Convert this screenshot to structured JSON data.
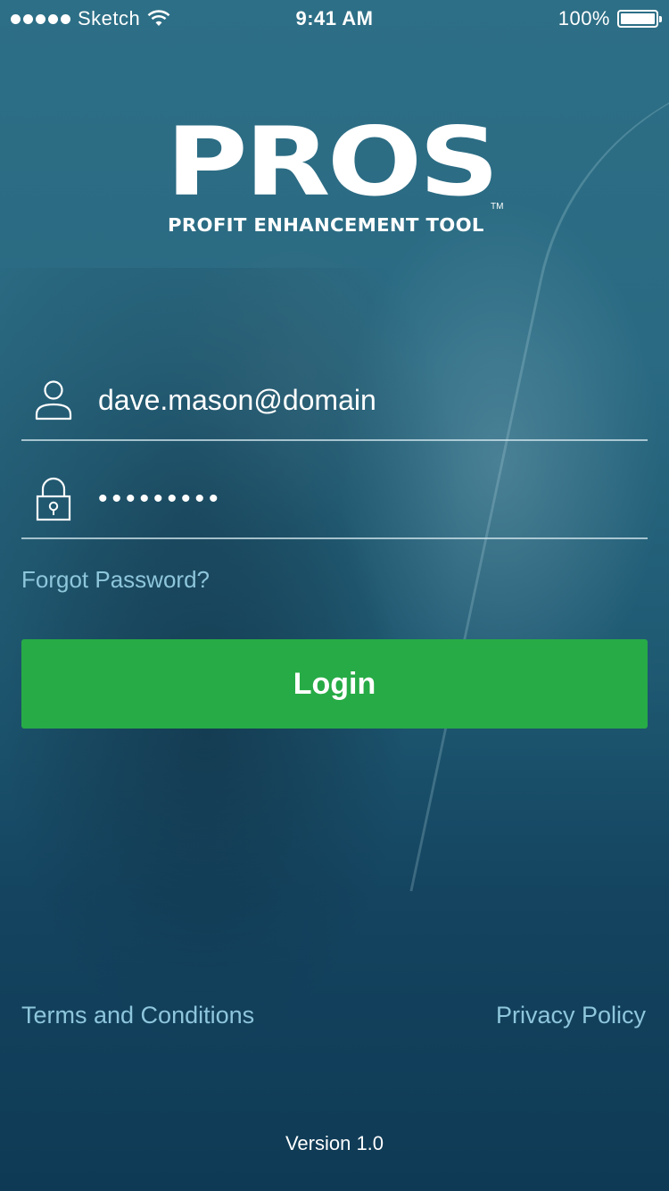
{
  "status_bar": {
    "carrier": "Sketch",
    "time": "9:41 AM",
    "battery_percent": "100%",
    "battery_level": 1.0
  },
  "logo": {
    "title": "PROS",
    "trademark": "TM",
    "subtitle": "PROFIT ENHANCEMENT TOOL"
  },
  "form": {
    "username_value": "dave.mason@domain",
    "password_value": "•••••••••",
    "forgot_label": "Forgot Password?",
    "login_label": "Login"
  },
  "footer": {
    "terms_label": "Terms and Conditions",
    "privacy_label": "Privacy Policy",
    "version": "Version 1.0"
  },
  "colors": {
    "accent_green": "#27ab46",
    "link_blue": "#8ec6dc",
    "background": "#1b4f67"
  },
  "icons": {
    "username": "user-icon",
    "password": "lock-icon",
    "wifi": "wifi-icon",
    "battery": "battery-icon"
  }
}
